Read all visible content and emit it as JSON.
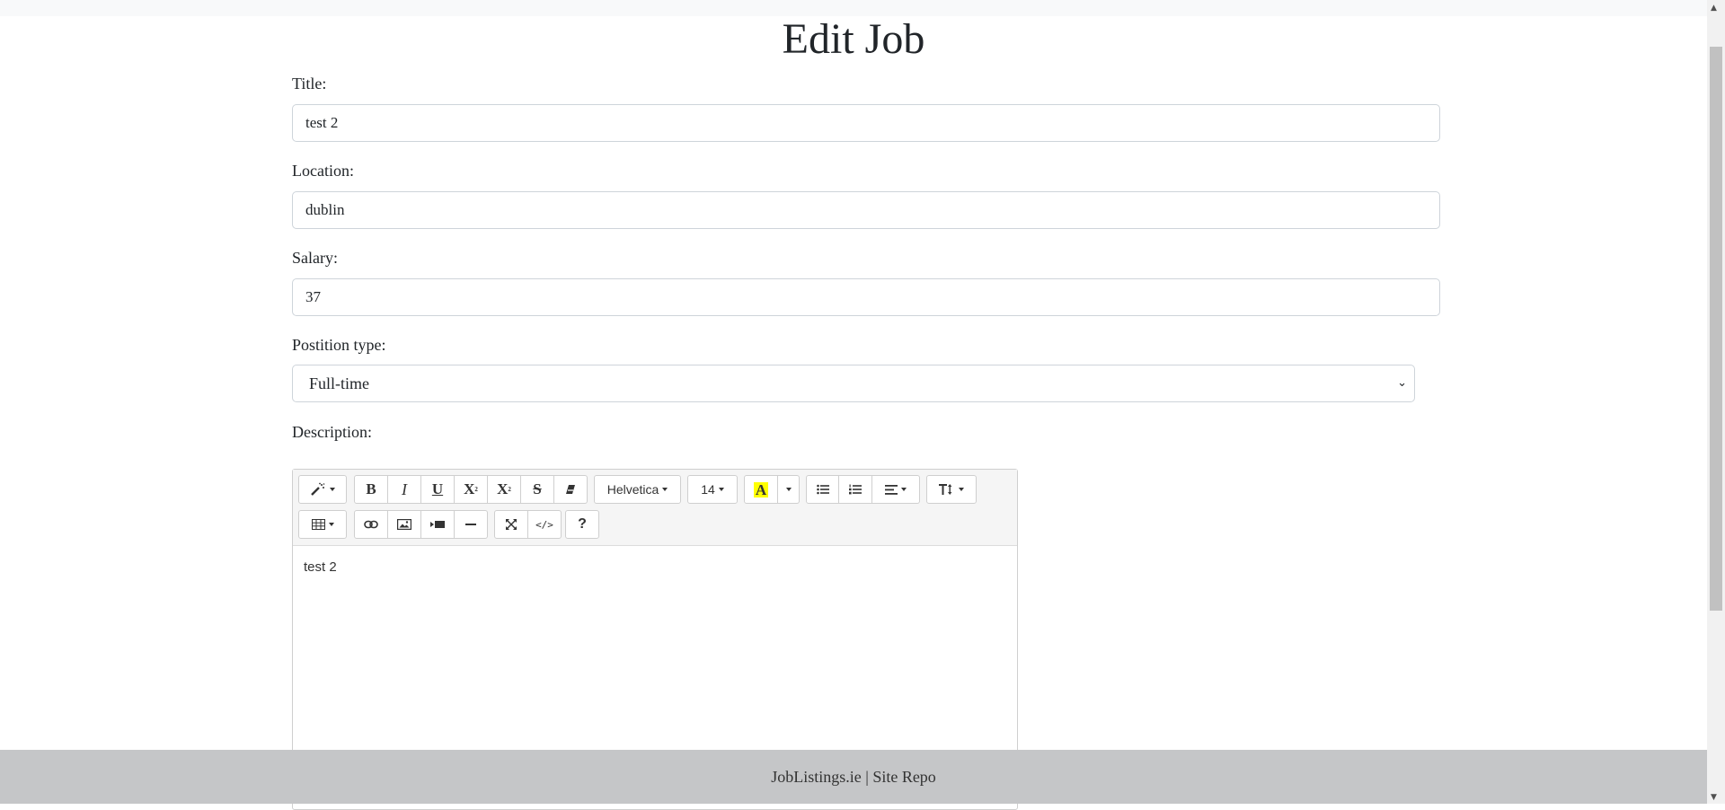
{
  "page": {
    "title": "Edit Job"
  },
  "form": {
    "title_label": "Title:",
    "title_value": "test 2",
    "location_label": "Location:",
    "location_value": "dublin",
    "salary_label": "Salary:",
    "salary_value": "37",
    "position_label": "Postition type:",
    "position_value": "Full-time",
    "description_label": "Description:"
  },
  "editor": {
    "font_name": "Helvetica",
    "font_size": "14",
    "color_letter": "A",
    "bold": "B",
    "italic": "I",
    "underline": "U",
    "superscript": "X",
    "subscript": "X",
    "strike": "S",
    "help": "?",
    "content": "test 2",
    "highlight_color": "#ffff00"
  },
  "footer": {
    "site_link": "JobListings.ie",
    "separator": "|",
    "repo_link": "Site Repo"
  }
}
